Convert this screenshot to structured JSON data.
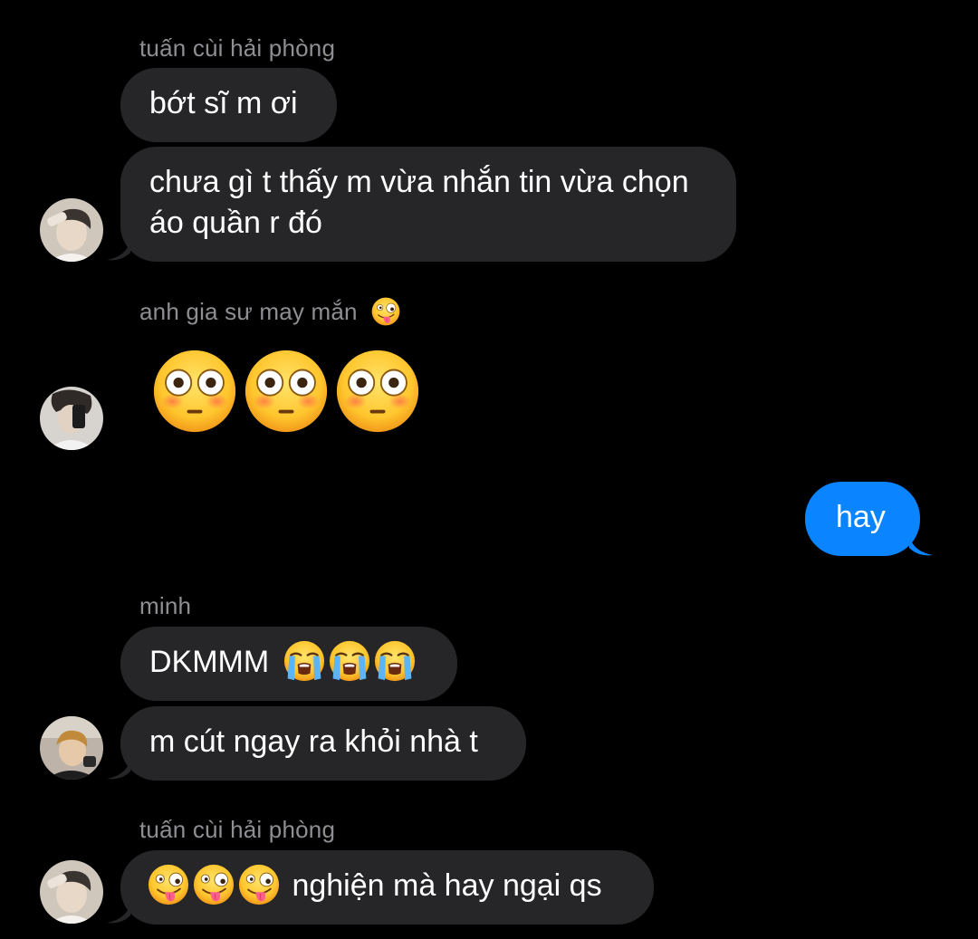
{
  "conversation": {
    "groups": [
      {
        "sender": "tuấn cùi hải phòng",
        "messages": [
          "bớt sĩ m ơi",
          "chưa gì t thấy m vừa nhắn tin vừa chọn áo quần r đó"
        ]
      },
      {
        "sender": "anh gia sư may mắn",
        "sender_emoji": "zany-face",
        "messages": [
          "😳😳😳"
        ]
      },
      {
        "sender": "",
        "outgoing": true,
        "messages": [
          "hay"
        ]
      },
      {
        "sender": "minh",
        "messages": [
          "DKMMM 😭😭😭",
          "m cút ngay ra khỏi nhà t"
        ]
      },
      {
        "sender": "tuấn cùi hải phòng",
        "messages": [
          "🤪🤪🤪 nghiện mà hay ngại qs"
        ]
      }
    ],
    "text": {
      "m1_text": "bớt sĩ m ơi",
      "m2_text": "chưa gì t thấy m vừa nhắn tin vừa chọn áo quần r đó",
      "m5_text": "DKMMM",
      "m6_text": "m cút ngay ra khỏi nhà t",
      "m7_text": "nghiện mà hay ngại qs"
    }
  },
  "colors": {
    "background": "#000000",
    "incoming_bubble": "#262628",
    "outgoing_bubble": "#0a84ff",
    "sender_name": "#8e8e93"
  },
  "icons": {
    "flushed": "flushed-face-emoji",
    "crying": "loudly-crying-face-emoji",
    "zany": "zany-face-emoji"
  }
}
